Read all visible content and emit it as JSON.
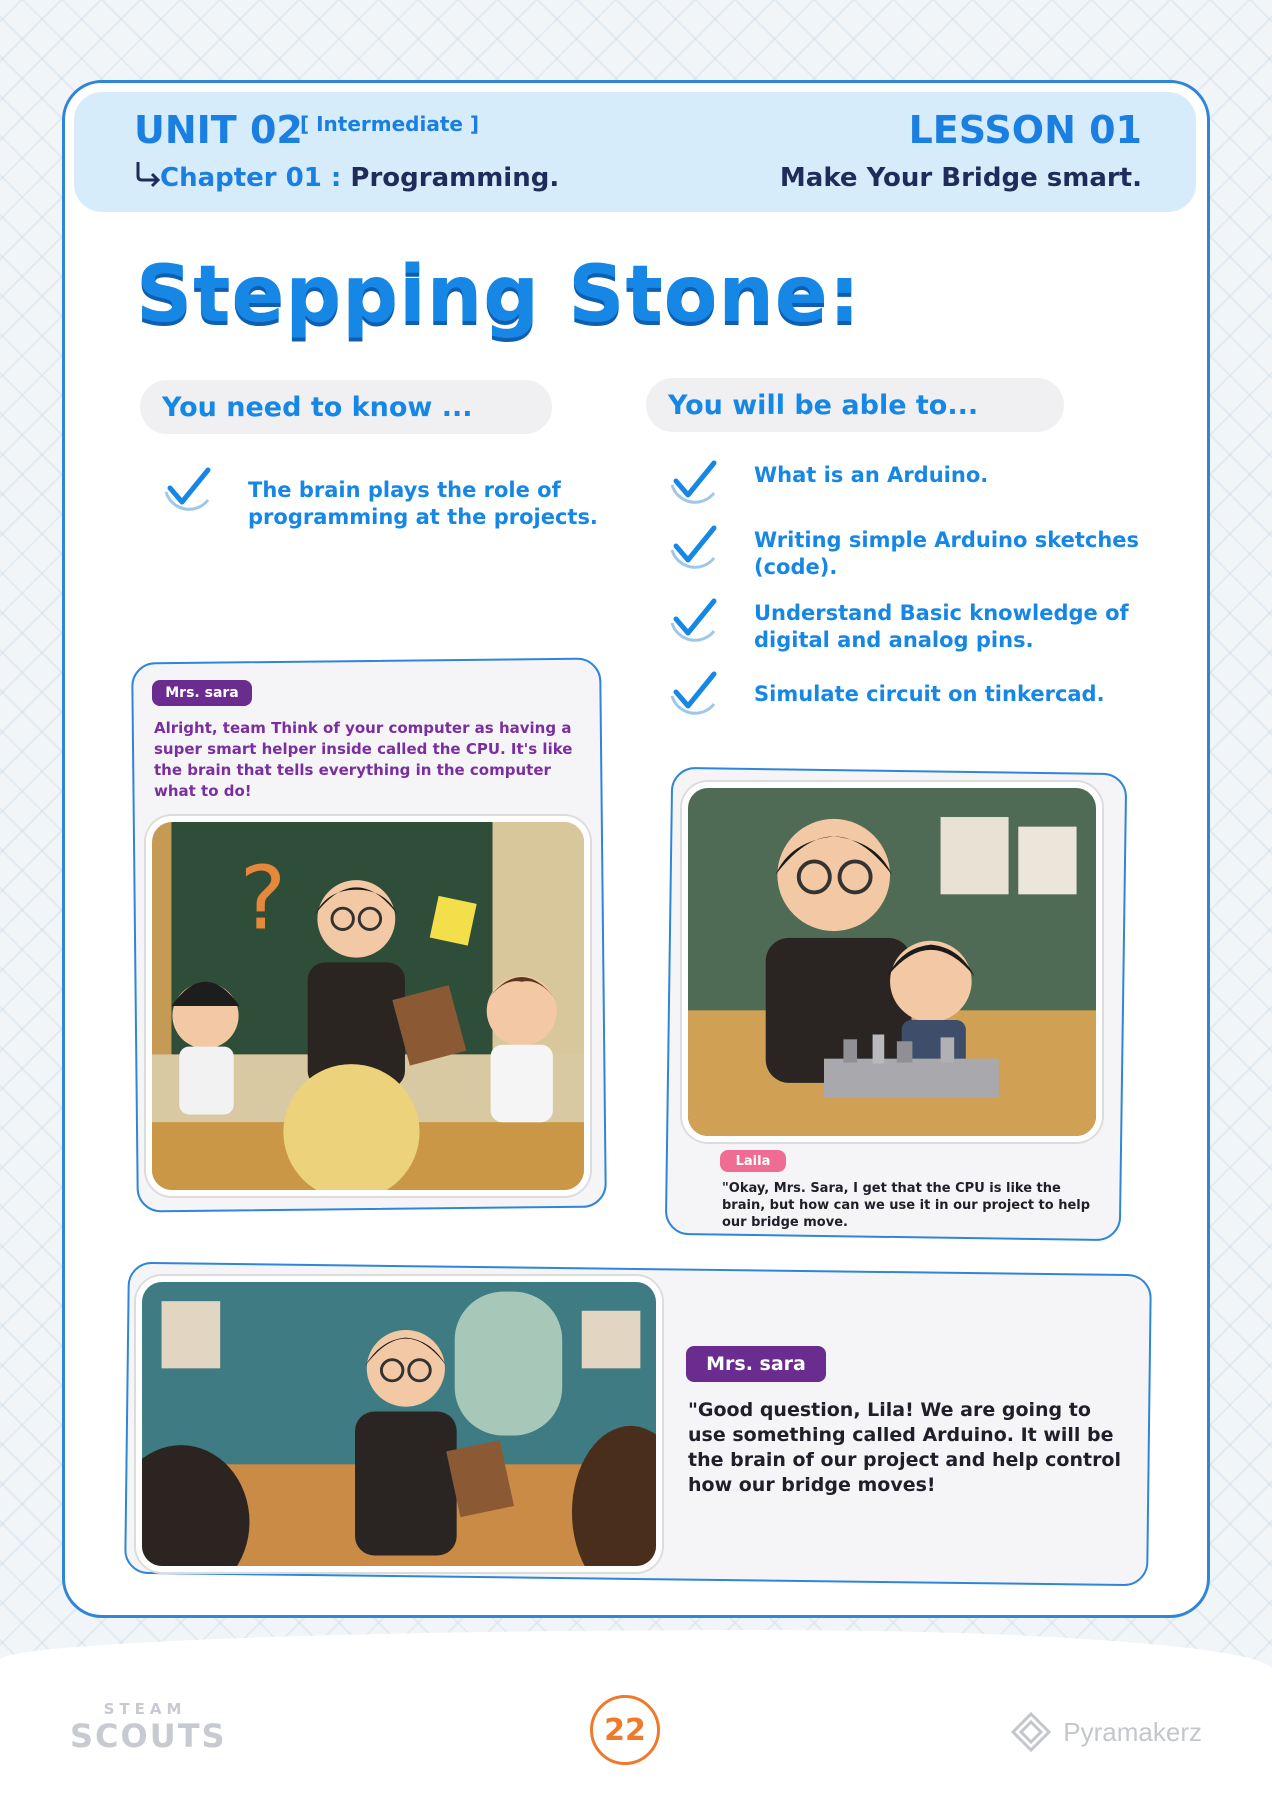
{
  "header": {
    "unit": "UNIT 02",
    "level": "[ Intermediate ]",
    "chapter_label": "Chapter 01 :",
    "chapter_name": "Programming.",
    "lesson": "LESSON 01",
    "lesson_title": "Make Your Bridge smart."
  },
  "title": "Stepping Stone:",
  "need_to_know": {
    "heading": "You need to know ...",
    "items": [
      "The brain plays the role of programming at the projects."
    ]
  },
  "able_to": {
    "heading": "You will be able to...",
    "items": [
      "What is an Arduino.",
      "Writing simple Arduino sketches (code).",
      "Understand Basic knowledge of digital and analog pins.",
      "Simulate circuit on tinkercad."
    ]
  },
  "dialogue": [
    {
      "speaker": "Mrs. sara",
      "text": "Alright, team Think of your computer as having a super smart helper inside called the CPU. It's like the brain that tells everything in the computer what to do!"
    },
    {
      "speaker": "Laila",
      "text": "\"Okay, Mrs. Sara, I get that the CPU is like the brain, but how can we use it in our project to help our bridge move."
    },
    {
      "speaker": "Mrs. sara",
      "text": "\"Good question, Lila! We are going to use something called Arduino. It will be the brain of our project and help control how our bridge moves!"
    }
  ],
  "footer": {
    "page_number": "22",
    "logo_left_top": "STEAM",
    "logo_left_bottom": "SCOUTS",
    "logo_right": "Pyramakerz"
  },
  "colors": {
    "accent_blue": "#1787e6",
    "navy": "#1f2b5a",
    "purple": "#6a2c8f",
    "pink": "#ef6d93",
    "orange": "#ef7a2b"
  }
}
